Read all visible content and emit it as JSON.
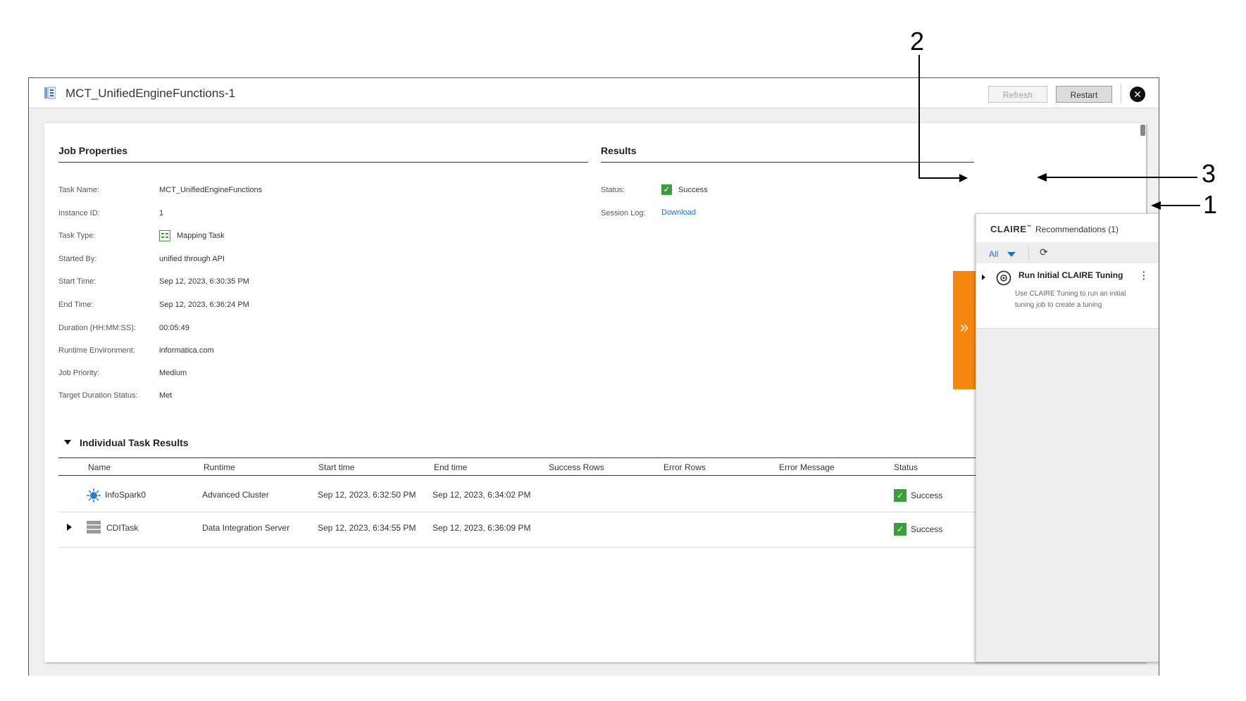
{
  "window": {
    "title": "MCT_UnifiedEngineFunctions-1",
    "refresh_label": "Refresh",
    "restart_label": "Restart",
    "close_icon": "✕"
  },
  "job_properties": {
    "heading": "Job Properties",
    "items": [
      {
        "label": "Task Name:",
        "value": "MCT_UnifiedEngineFunctions"
      },
      {
        "label": "Instance ID:",
        "value": "1"
      },
      {
        "label": "Task Type:",
        "value": "Mapping Task"
      },
      {
        "label": "Started By:",
        "value": "unified through API"
      },
      {
        "label": "Start Time:",
        "value": "Sep 12, 2023, 6:30:35 PM"
      },
      {
        "label": "End Time:",
        "value": "Sep 12, 2023, 6:36:24 PM"
      },
      {
        "label": "Duration (HH:MM:SS):",
        "value": "00:05:49"
      },
      {
        "label": "Runtime Environment:",
        "value": "informatica.com"
      },
      {
        "label": "Job Priority:",
        "value": "Medium"
      },
      {
        "label": "Target Duration Status:",
        "value": "Met"
      }
    ]
  },
  "results": {
    "heading": "Results",
    "status_label": "Status:",
    "status_value": "Success",
    "session_log_label": "Session Log:",
    "session_log_link": "Download"
  },
  "task_results": {
    "heading": "Individual Task Results",
    "columns": [
      "Name",
      "Runtime",
      "Start time",
      "End time",
      "Success Rows",
      "Error Rows",
      "Error Message",
      "Status"
    ],
    "rows": [
      {
        "name": "InfoSpark0",
        "runtime": "Advanced Cluster",
        "start": "Sep 12, 2023, 6:32:50 PM",
        "end": "Sep 12, 2023, 6:34:02 PM",
        "status": "Success"
      },
      {
        "name": "CDITask",
        "runtime": "Data Integration Server",
        "start": "Sep 12, 2023, 6:34:55 PM",
        "end": "Sep 12, 2023, 6:36:09 PM",
        "status": "Success"
      }
    ]
  },
  "claire": {
    "brand": "CLAIRE",
    "tm": "™",
    "title": "Recommendations (1)",
    "filter": "All",
    "recommendation_title": "Run Initial CLAIRE Tuning",
    "recommendation_desc_1": "Use CLAIRE Tuning to run an initial",
    "recommendation_desc_2": "tuning job to create a tuning",
    "expand_glyph": "»"
  },
  "callouts": [
    "1",
    "2",
    "3"
  ],
  "colors": {
    "accent_orange": "#f7860f",
    "link_blue": "#1d6fd8",
    "success_green": "#3a9e3a"
  }
}
